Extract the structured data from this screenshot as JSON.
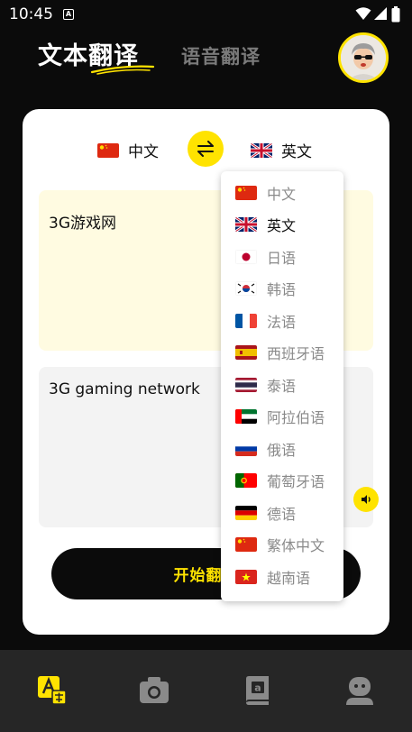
{
  "status_bar": {
    "time": "10:45",
    "notif_glyph": "A"
  },
  "header": {
    "tab_text": "文本翻译",
    "tab_voice": "语音翻译",
    "accent_color": "#ffe300"
  },
  "translator": {
    "source_lang": "中文",
    "target_lang": "英文",
    "input_text": "3G游戏网",
    "output_text": "3G gaming network",
    "start_label": "开始翻译"
  },
  "dropdown": {
    "selected_index": 1,
    "options": [
      {
        "label": "中文",
        "flag": "cn"
      },
      {
        "label": "英文",
        "flag": "gb"
      },
      {
        "label": "日语",
        "flag": "jp"
      },
      {
        "label": "韩语",
        "flag": "kr"
      },
      {
        "label": "法语",
        "flag": "fr"
      },
      {
        "label": "西班牙语",
        "flag": "es"
      },
      {
        "label": "泰语",
        "flag": "th"
      },
      {
        "label": "阿拉伯语",
        "flag": "ae"
      },
      {
        "label": "俄语",
        "flag": "ru"
      },
      {
        "label": "葡萄牙语",
        "flag": "pt"
      },
      {
        "label": "德语",
        "flag": "de"
      },
      {
        "label": "繁体中文",
        "flag": "cn"
      },
      {
        "label": "越南语",
        "flag": "vn"
      }
    ]
  },
  "bottom_nav": {
    "items": [
      {
        "icon": "translate-icon",
        "active": true
      },
      {
        "icon": "camera-icon",
        "active": false
      },
      {
        "icon": "book-icon",
        "active": false
      },
      {
        "icon": "profile-icon",
        "active": false
      }
    ]
  }
}
